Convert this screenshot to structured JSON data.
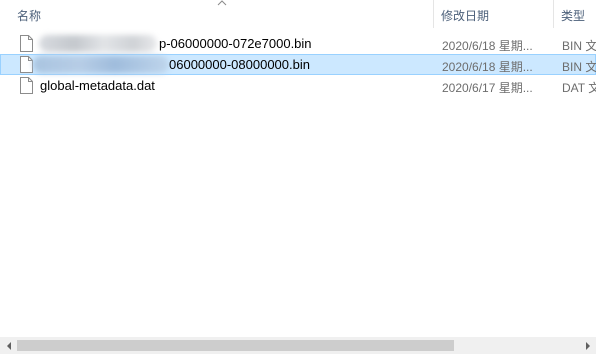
{
  "columns": {
    "name": "名称",
    "modified": "修改日期",
    "type": "类型"
  },
  "files": [
    {
      "name": "p-06000000-072e7000.bin",
      "date": "2020/6/18 星期...",
      "type": "BIN 文",
      "selected": false,
      "name_obscured": true
    },
    {
      "name": "06000000-08000000.bin",
      "date": "2020/6/18 星期...",
      "type": "BIN 文",
      "selected": true,
      "name_obscured": true
    },
    {
      "name": "global-metadata.dat",
      "date": "2020/6/17 星期...",
      "type": "DAT 文",
      "selected": false,
      "name_obscured": false
    }
  ],
  "icons": {
    "file": "file-icon",
    "sort": "sort-ascending-icon",
    "scroll_left": "scroll-left-icon",
    "scroll_right": "scroll-right-icon"
  },
  "colors": {
    "selection_bg": "#cce8ff",
    "selection_border": "#99d1ff",
    "header_text": "#4c607a"
  }
}
